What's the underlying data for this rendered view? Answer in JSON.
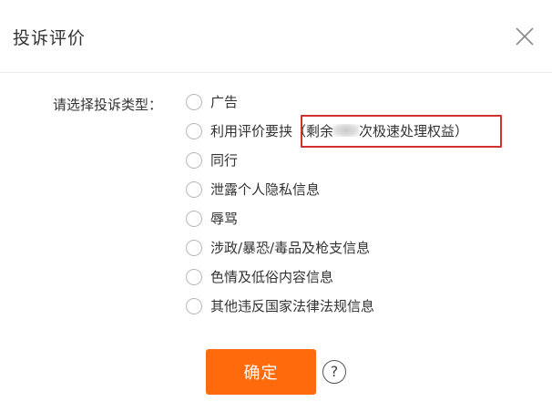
{
  "dialog": {
    "title": "投诉评价",
    "close_icon": "close-icon"
  },
  "form": {
    "type_label": "请选择投诉类型：",
    "options": [
      {
        "label": "广告"
      },
      {
        "label": "利用评价要挟",
        "note_prefix": "（剩余",
        "note_suffix": "次极速处理权益）"
      },
      {
        "label": "同行"
      },
      {
        "label": "泄露个人隐私信息"
      },
      {
        "label": "辱骂"
      },
      {
        "label": "涉政/暴恐/毒品及枪支信息"
      },
      {
        "label": "色情及低俗内容信息"
      },
      {
        "label": "其他违反国家法律法规信息"
      }
    ]
  },
  "actions": {
    "confirm_label": "确定",
    "help_label": "?"
  },
  "colors": {
    "primary": "#ff6a0d",
    "highlight_border": "#d32f2f"
  }
}
